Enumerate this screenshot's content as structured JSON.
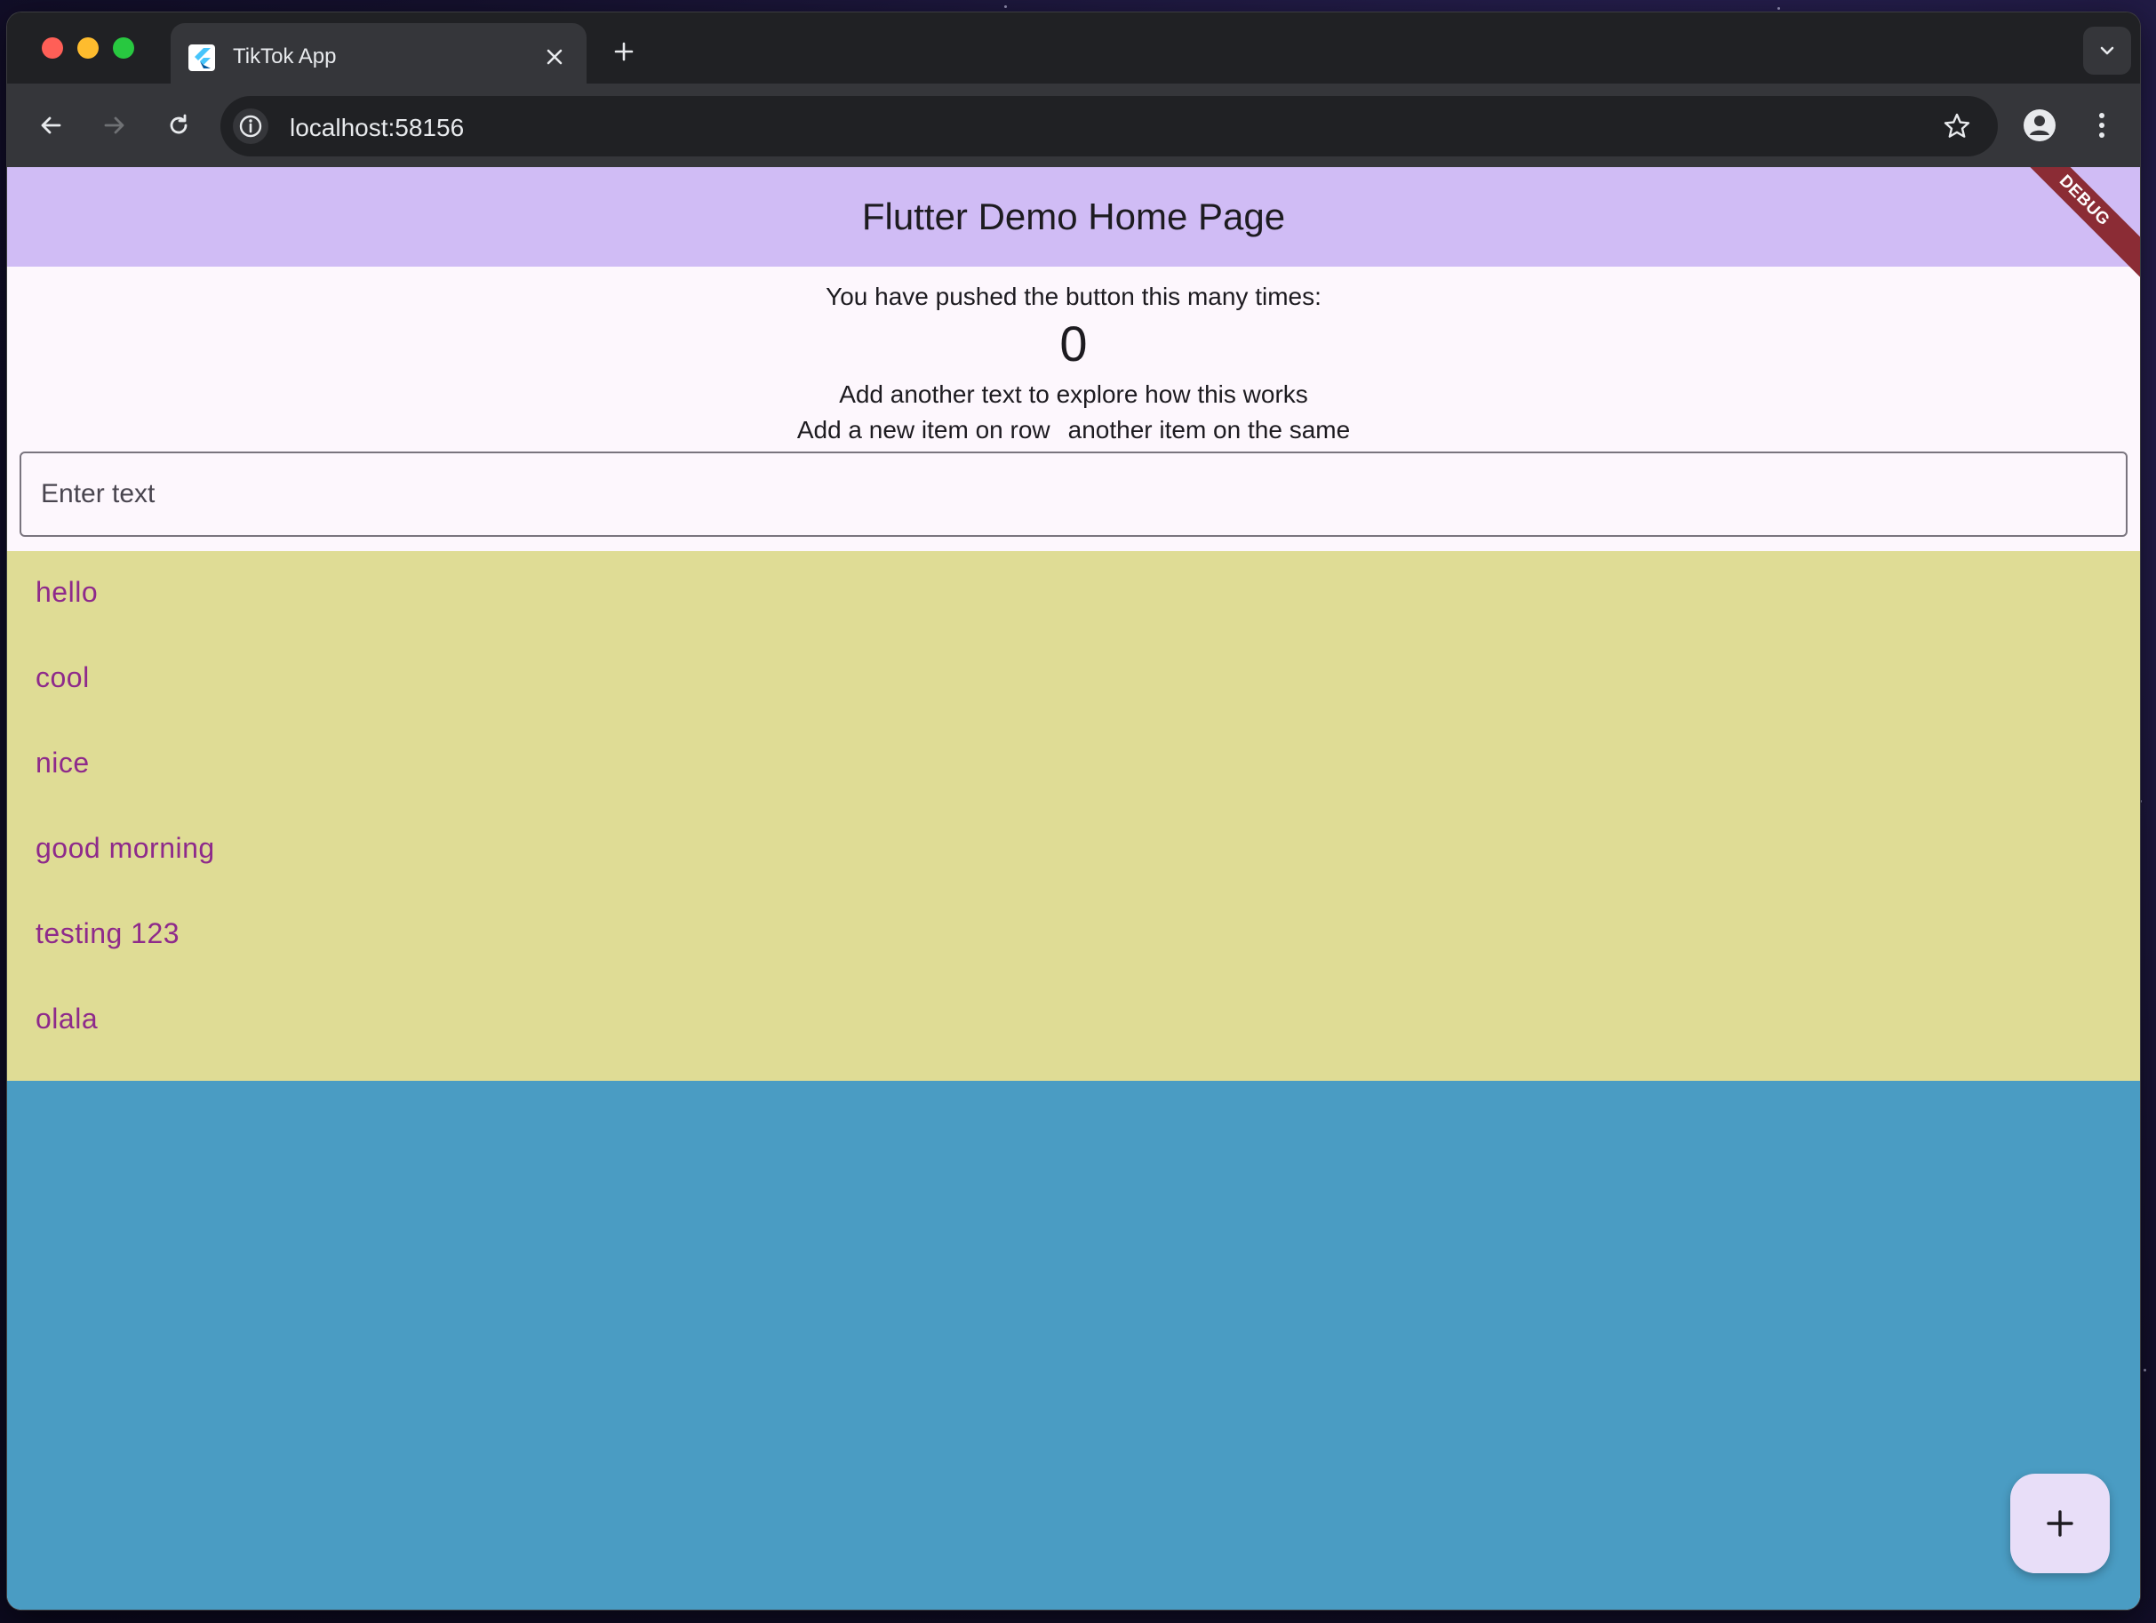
{
  "browser": {
    "tab_title": "TikTok App",
    "url": "localhost:58156"
  },
  "app": {
    "title": "Flutter Demo Home Page",
    "debug_banner": "DEBUG",
    "counter_label": "You have pushed the button this many times:",
    "counter_value": "0",
    "explore_text": "Add another text to explore how this works",
    "row_text_left": "Add a new item on row",
    "row_text_right": "another item on the same",
    "input_placeholder": "Enter text",
    "input_value": "",
    "items": [
      "hello",
      "cool",
      "nice",
      "good morning",
      "testing 123",
      "olala"
    ],
    "fab_icon": "plus-icon"
  },
  "colors": {
    "appbar": "#d0bcf5",
    "list_background": "#dfdc95",
    "list_text": "#8e2a8b",
    "blue_section": "#4a9cc3",
    "fab": "#e8def8",
    "debug_banner": "#8b2c35"
  }
}
